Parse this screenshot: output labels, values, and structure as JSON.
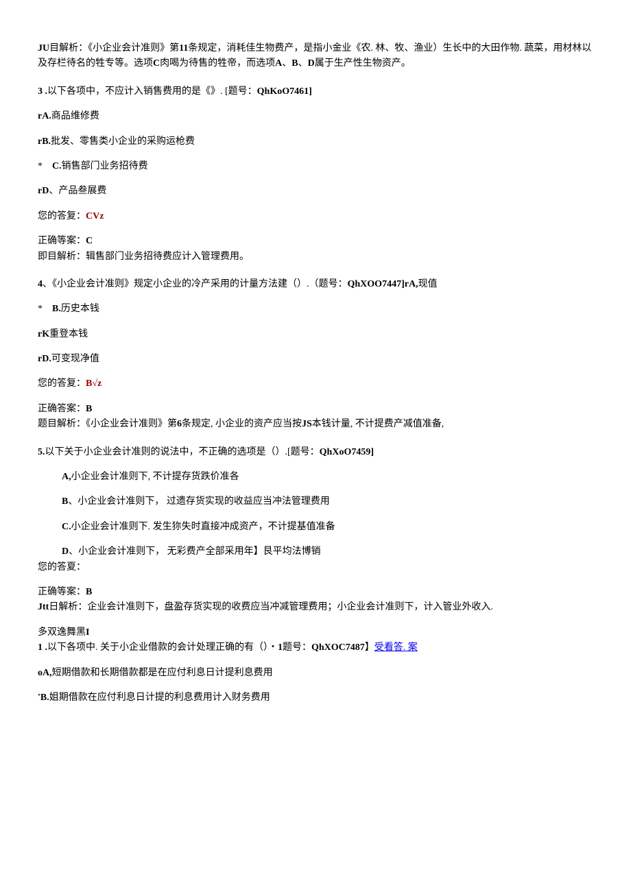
{
  "intro_analysis": {
    "label": "JU",
    "text1": "目解析：《小企业会计准则》第",
    "bold11": "11",
    "text2": "条规定，消耗佳生物费产，是指小金业《农. 林、牧、渔业）生长中的大田作物. 蔬菜，用材林以及存栏待名的牲专等。选项",
    "boldC": "C",
    "text3": "肉喝为待售的牲帝，而选项",
    "boldA": "A",
    "text4": "、",
    "boldB": "B",
    "text5": "、",
    "boldD": "D",
    "text6": "属于生产性生物资产。"
  },
  "q3": {
    "num": "3 .",
    "stem1": "以下各项中，不应计入销售费用的是《》. [题号：",
    "code": "QhKoO7461]",
    "optA_pre": "r",
    "optA_b": "A.",
    "optA_text": "商品维修费",
    "optB_pre": "r",
    "optB_b": "B.",
    "optB_text": "批发、零售类小企业的采购运枪费",
    "optC_pre": "*    ",
    "optC_b": "C.",
    "optC_text": "销售部门业务招待费",
    "optD_pre": "r",
    "optD_b": "D",
    "optD_text": "、产品叁展费",
    "your_answer_label": "您的答复：",
    "your_answer": "CVz",
    "correct_label": "正确等案：",
    "correct": "C",
    "analysis": "即目解析：辑售部门业务招待费应计入管理费用。"
  },
  "q4": {
    "num": "4",
    "stem1": "、《小企业会计准则》规定小企业的冷产采用的计量方法建（）.（题号：",
    "code": "QhXOO7447]rA,",
    "stem_tail": "现值",
    "optB_pre": "*    ",
    "optB_b": "B.",
    "optB_text": "历史本钱",
    "optC_pre": "r",
    "optC_b": "K",
    "optC_text": "重登本钱",
    "optD_pre": "r",
    "optD_b": "D.",
    "optD_text": "可变现净值",
    "your_answer_label": "您的答复：",
    "your_answer": "B√z",
    "correct_label": "正确答案：",
    "correct": "B",
    "analysis1": "题目解析：《小企业会计准则》第",
    "analysis_b6": "6",
    "analysis2": "条规定, 小企业的资产应当按",
    "analysis_js": "JS",
    "analysis3": "本钱计量, 不计提费产减值准备,"
  },
  "q5": {
    "num": "5.",
    "stem1": "以下关于小企业会计准则的说法中，不正确的选项是（）.[题号：",
    "code": "QhXoO7459]",
    "optA_b": "A,",
    "optA_text": "小企业会计准则下, 不计提存货跌价准各",
    "optB_b": "B",
    "optB_text": "、小企业会计准则下，  过遗存货实现的收益应当冲法管理费用",
    "optC_b": "C.",
    "optC_text": "小企业会计准则下.    发生狝失时直接冲成资产，不计提基值准备",
    "optD_b": "D",
    "optD_text": "、小企业会计准则下，  无彩费产全部采用年】艮平均法博销",
    "your_answer_label": "您的答夏：",
    "correct_label": "正确等案：",
    "correct": "B",
    "analysis_b": "Jtt",
    "analysis": "日解析：企业会计准则下，盘盈存货实现的收费应当冲减管理费用；小企业会计准则下，计入管业外收入."
  },
  "multi": {
    "header": "多双逸舞黑",
    "header_b": "I",
    "q1_num": "1 .",
    "q1_stem1": "以下各项中. 关于小企业借款的会计处理正确的有（）・",
    "q1_b1": "1",
    "q1_stem2": "题号：",
    "q1_code": "QhXOC7487",
    "q1_bracket": "】",
    "q1_link": "受看答. 案",
    "optA_pre": "o",
    "optA_b": "A,",
    "optA_text": "短期借款和长期借款都是在应付利息日计提利息费用",
    "optB_pre": "'",
    "optB_b": "B.",
    "optB_text": "姐期借款在应付利息日计提的利息费用计入财务费用"
  }
}
